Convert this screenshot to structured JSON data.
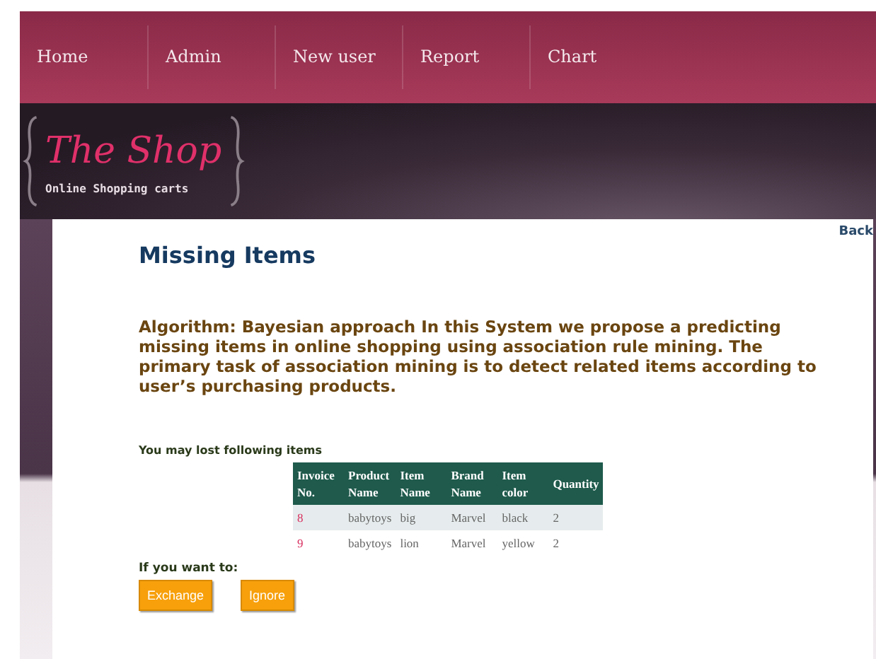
{
  "nav": [
    {
      "label": "Home"
    },
    {
      "label": "Admin"
    },
    {
      "label": "New user"
    },
    {
      "label": "Report"
    },
    {
      "label": "Chart"
    }
  ],
  "logo": {
    "title": "The Shop",
    "tagline": "Online Shopping carts"
  },
  "back_link": "Back",
  "heading": "Missing Items",
  "description": "Algorithm: Bayesian approach In this System we propose a predicting missing items in online shopping using association rule mining. The primary task of association mining is to detect related items according to user’s purchasing products.",
  "table_caption": "You may lost following items",
  "table": {
    "columns": [
      "Invoice No.",
      "Product Name",
      "Item Name",
      "Brand Name",
      "Item color",
      "Quantity"
    ],
    "rows": [
      [
        "8",
        "babytoys",
        "big",
        "Marvel",
        "black",
        "2"
      ],
      [
        "9",
        "babytoys",
        "lion",
        "Marvel",
        "yellow",
        "2"
      ]
    ]
  },
  "prompt": "If you want to:",
  "buttons": [
    "Exchange",
    "Ignore"
  ]
}
